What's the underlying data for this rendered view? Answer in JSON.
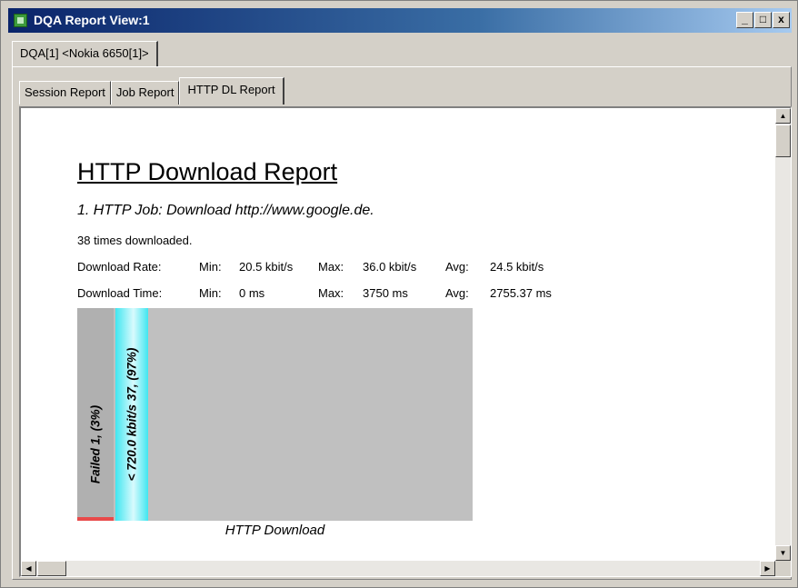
{
  "window": {
    "title": "DQA Report View:1",
    "controls": {
      "minimize": "_",
      "maximize": "□",
      "close": "x"
    }
  },
  "document_tab": {
    "label": "DQA[1] <Nokia 6650[1]>"
  },
  "report_tabs": [
    {
      "label": "Session Report"
    },
    {
      "label": "Job Report"
    },
    {
      "label": "HTTP DL Report",
      "active": true
    }
  ],
  "report": {
    "title": "HTTP Download Report",
    "job": "1. HTTP Job: Download http://www.google.de.",
    "downloads": "38 times downloaded.",
    "download_rate": {
      "label": "Download Rate:",
      "min_label": "Min:",
      "min": "20.5 kbit/s",
      "max_label": "Max:",
      "max": "36.0 kbit/s",
      "avg_label": "Avg:",
      "avg": "24.5 kbit/s"
    },
    "download_time": {
      "label": "Download Time:",
      "min_label": "Min:",
      "min": "0 ms",
      "max_label": "Max:",
      "max": "3750 ms",
      "avg_label": "Avg:",
      "avg": "2755.37 ms"
    }
  },
  "chart_data": {
    "type": "bar",
    "title": "HTTP Download",
    "categories": [
      "Failed",
      "< 720.0 kbit/s"
    ],
    "values": [
      1,
      37
    ],
    "percent": [
      3,
      97
    ],
    "labels": [
      "Failed 1, (3%)",
      "< 720.0 kbit/s 37, (97%)"
    ],
    "colors": [
      "#e84a4a",
      "#40e6f0"
    ]
  },
  "scrollbars": {
    "up": "▲",
    "down": "▼",
    "left": "◀",
    "right": "▶"
  }
}
